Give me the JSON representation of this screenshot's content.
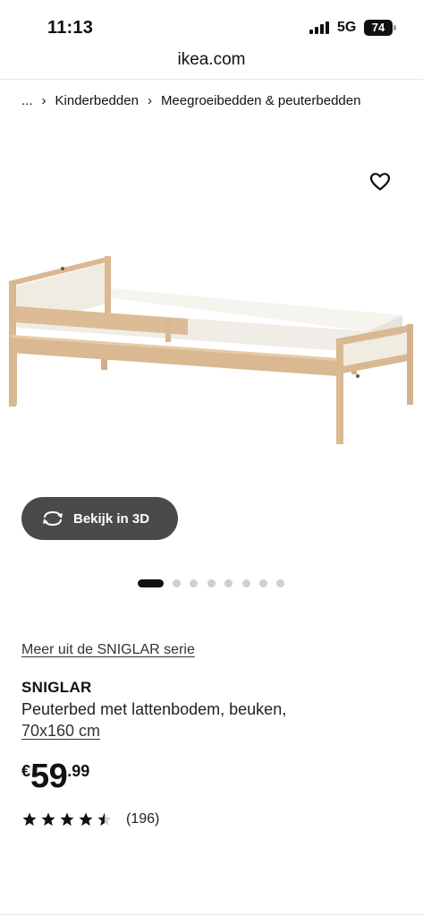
{
  "status_bar": {
    "time": "11:13",
    "network": "5G",
    "battery": "74"
  },
  "browser": {
    "url": "ikea.com"
  },
  "breadcrumb": {
    "ellipsis": "...",
    "items": [
      "Kinderbedden",
      "Meegroeibedden & peuterbedden"
    ]
  },
  "gallery": {
    "view_3d_label": "Bekijk in 3D",
    "image_alt": "SNIGLAR peuterbed",
    "dots_total": 8,
    "active_index": 0
  },
  "product": {
    "series_link": "Meer uit de SNIGLAR serie",
    "name": "SNIGLAR",
    "description": "Peuterbed met lattenbodem, beuken,",
    "size": "70x160 cm",
    "price": {
      "currency": "€",
      "integer": "59",
      "decimal": ".99"
    },
    "rating": {
      "value": 4.5,
      "max": 5,
      "reviews": "(196)"
    }
  },
  "colors": {
    "accent": "#111111",
    "button_bg": "#4a4a4a",
    "wood": "#d9b892",
    "mattress": "#f4f2ec"
  }
}
